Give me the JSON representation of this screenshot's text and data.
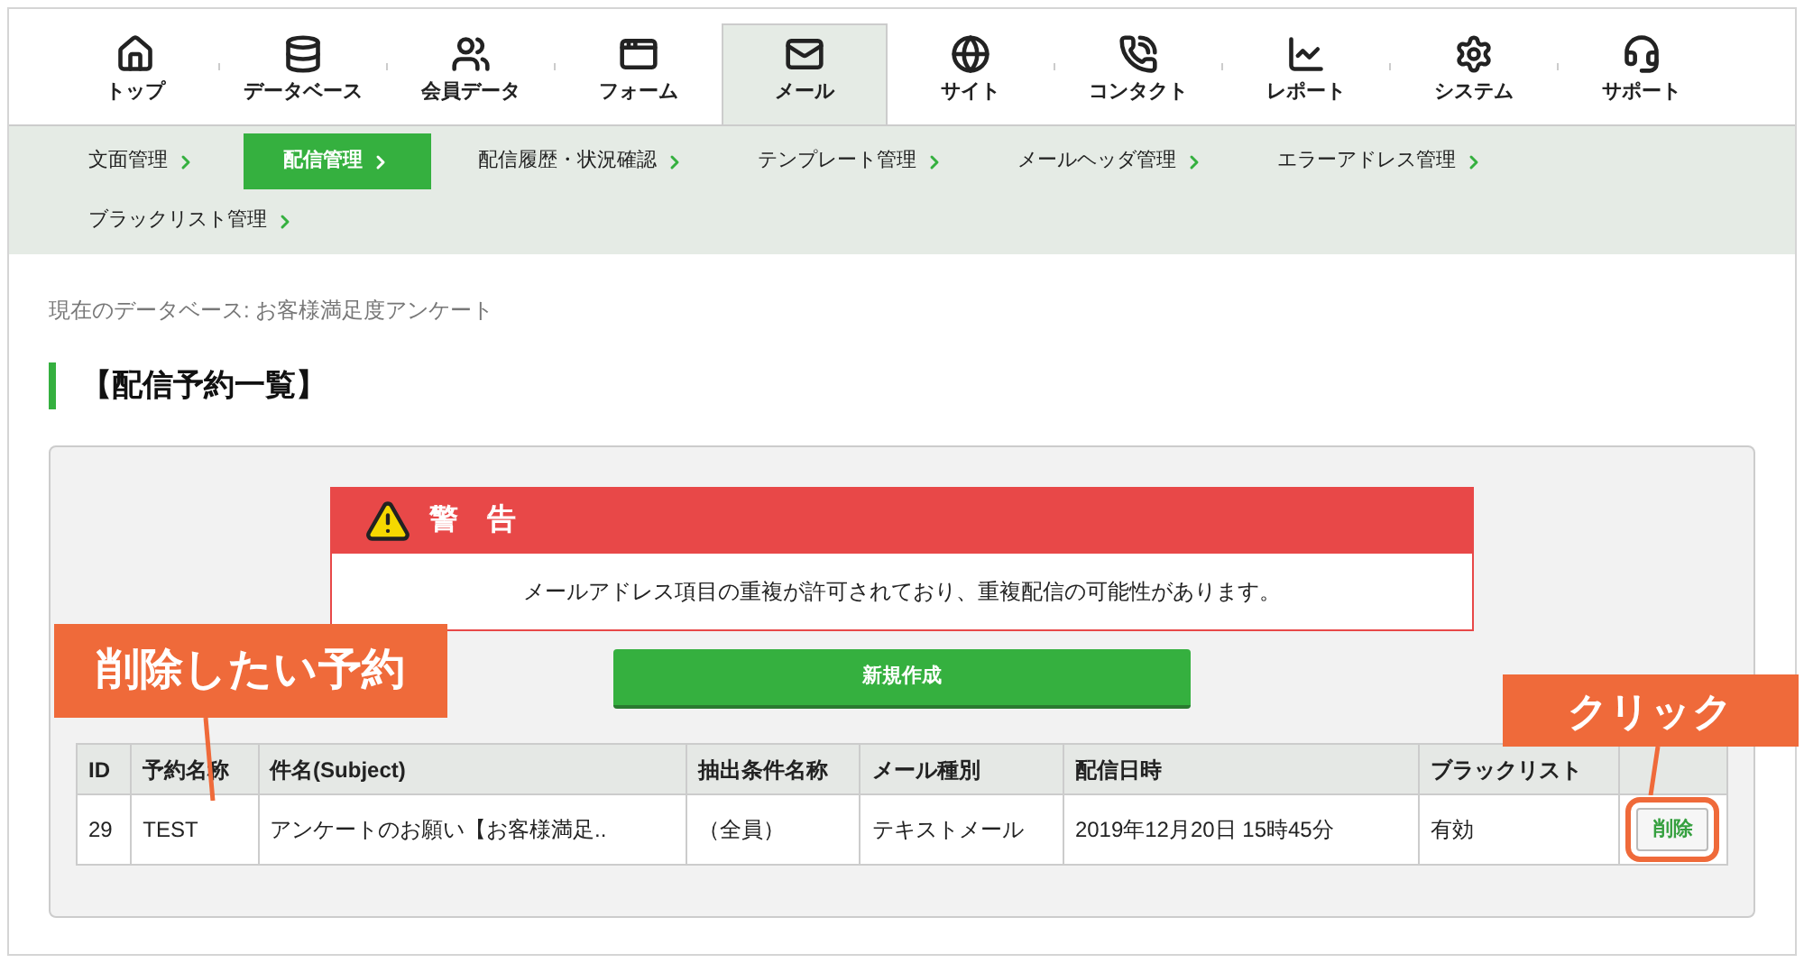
{
  "nav_tabs": [
    {
      "label": "トップ",
      "selected": false
    },
    {
      "label": "データベース",
      "selected": false
    },
    {
      "label": "会員データ",
      "selected": false
    },
    {
      "label": "フォーム",
      "selected": false
    },
    {
      "label": "メール",
      "selected": true
    },
    {
      "label": "サイト",
      "selected": false
    },
    {
      "label": "コンタクト",
      "selected": false
    },
    {
      "label": "レポート",
      "selected": false
    },
    {
      "label": "システム",
      "selected": false
    },
    {
      "label": "サポート",
      "selected": false
    }
  ],
  "sub_nav": [
    {
      "label": "文面管理",
      "selected": false
    },
    {
      "label": "配信管理",
      "selected": true
    },
    {
      "label": "配信履歴・状況確認",
      "selected": false
    },
    {
      "label": "テンプレート管理",
      "selected": false
    },
    {
      "label": "メールヘッダ管理",
      "selected": false
    },
    {
      "label": "エラーアドレス管理",
      "selected": false
    },
    {
      "label": "ブラックリスト管理",
      "selected": false
    }
  ],
  "current_database": "現在のデータベース: お客様満足度アンケート",
  "heading": "【配信予約一覧】",
  "warning": {
    "title": "警　告",
    "message": "メールアドレス項目の重複が許可されており、重複配信の可能性があります。"
  },
  "new_button": "新規作成",
  "table": {
    "columns": [
      "ID",
      "予約名称",
      "件名(Subject)",
      "抽出条件名称",
      "メール種別",
      "配信日時",
      "ブラックリスト"
    ],
    "rows": [
      {
        "cells": [
          "29",
          "TEST",
          "アンケートのお願い【お客様満足..",
          "（全員）",
          "テキストメール",
          "2019年12月20日 15時45分",
          "有効"
        ],
        "action": "削除"
      }
    ]
  },
  "annotations": [
    "削除したい予約",
    "クリック"
  ]
}
